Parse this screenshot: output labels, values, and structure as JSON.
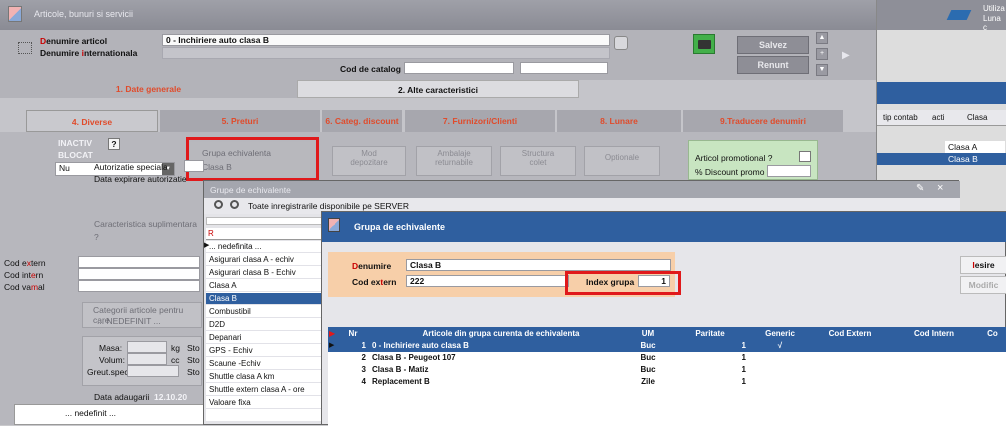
{
  "main": {
    "title": "Articole, bunuri si servicii",
    "denumire_label_a": "D",
    "denumire_label_b": "enumire articol",
    "denumire_value": "0 - Inchiriere auto clasa B",
    "den_int_label_a": "Denumire ",
    "den_int_label_b": "i",
    "den_int_label_c": "nternationala",
    "catalog_label": "Cod de catalog :",
    "save_label": "Salvez",
    "cancel_label": "Renunt",
    "tab1": "1. Date generale",
    "tab2": "2. Alte caracteristici",
    "subtabs": [
      "4. Diverse",
      "5. Preturi",
      "6. Categ. discount",
      "7. Furnizori/Clienti",
      "8. Lunare",
      "9.Traducere denumiri"
    ],
    "inactiv_label": "INACTIV",
    "blocat_label": "BLOCAT",
    "nu_value": "Nu",
    "help_label": "?",
    "grupa_label": "Grupa echivalenta",
    "grupa_value": "Clasa B",
    "mod_depozitare": "Mod\ndepozitare",
    "ambalaje": "Ambalaje\nreturnabile",
    "structura": "Structura\ncolet",
    "optionale": "Optionale",
    "promo_label": "Articol promotional ?",
    "discount_label": "% Discount promo",
    "autorizatie_label": "Autorizatie speciala",
    "data_expirare_label": "Data expirare autorizatie",
    "caracteristica_label": "Caracteristica suplimentara",
    "cod_extern_a": "Cod e",
    "cod_extern_b": "x",
    "cod_extern_c": "tern",
    "cod_intern_a": "Cod int",
    "cod_intern_b": "e",
    "cod_intern_c": "rn",
    "cod_vamal_a": "Cod va",
    "cod_vamal_b": "m",
    "cod_vamal_c": "al",
    "categorii_label": "Categorii articole pentru care",
    "nedefinit_label": "... NEDEFINIT ...",
    "masa_label": "Masa:",
    "kg_label": "kg",
    "volum_label": "Volum:",
    "cc_label": "cc",
    "greut_label": "Greut.spec.:",
    "sto_label": "Sto",
    "data_adaugarii_label": "Data adaugarii",
    "data_adaugarii_value": "12.10.20",
    "bottom_nedefinit": "... nedefinit ..."
  },
  "right_panel": {
    "user_label": "Utiliza",
    "luna_label": "Luna c",
    "col_tip": "tip contab",
    "col_acti": "acti",
    "col_clasa": "Clasa",
    "rows": [
      "Clasa A",
      "Clasa B"
    ]
  },
  "popup_list": {
    "title": "Grupe de echivalente",
    "toolbar_text": "Toate inregistrarile disponibile pe SERVER",
    "edit_icon": "pencil-icon",
    "close_label": "×",
    "items": [
      "... nedefinita ...",
      "Asigurari clasa A - echiv",
      "Asigurari clasa B - Echiv",
      "Clasa A",
      "Clasa B",
      "Combustibil",
      "D2D",
      "Depanari",
      "GPS - Echiv",
      "Scaune -Echiv",
      "Shuttle clasa A km",
      "Shuttle extern clasa A - ore",
      "Valoare fixa"
    ],
    "selected_index": 4
  },
  "detail": {
    "title": "Grupa de echivalente",
    "denumire_label_a": "D",
    "denumire_label_b": "enumire",
    "denumire_value": "Clasa B",
    "cod_extern_label_a": "Cod ex",
    "cod_extern_label_b": "t",
    "cod_extern_label_c": "ern",
    "cod_extern_value": "222",
    "index_label": "Index grupa",
    "index_value": "1",
    "iesire_label_a": "I",
    "iesire_label_b": "esire",
    "modific_label": "Modific",
    "columns": [
      "Nr",
      "Articole din grupa curenta de echivalenta",
      "UM",
      "Paritate",
      "Generic",
      "Cod Extern",
      "Cod Intern",
      "Co"
    ],
    "rows": [
      {
        "nr": "1",
        "name": "0 - Inchiriere auto clasa B",
        "um": "Buc",
        "paritate": "1",
        "generic": "√"
      },
      {
        "nr": "2",
        "name": "Clasa B - Peugeot 107",
        "um": "Buc",
        "paritate": "1",
        "generic": ""
      },
      {
        "nr": "3",
        "name": "Clasa B - Matiz",
        "um": "Buc",
        "paritate": "1",
        "generic": ""
      },
      {
        "nr": "4",
        "name": "Replacement B",
        "um": "Zile",
        "paritate": "1",
        "generic": ""
      }
    ]
  },
  "colors": {
    "accent_blue": "#2f5f9f",
    "highlight_red": "#e0191b",
    "salmon_panel": "#f7cfa9"
  }
}
